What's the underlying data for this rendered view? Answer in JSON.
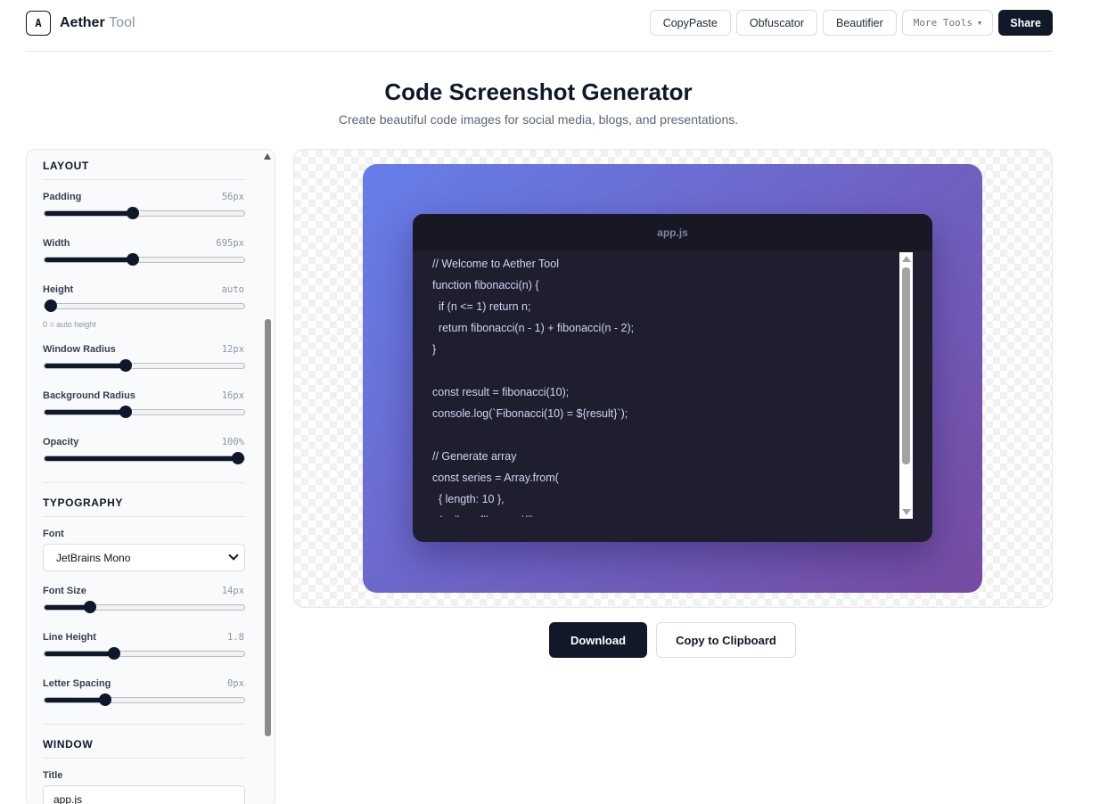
{
  "header": {
    "logo_letter": "A",
    "brand_main": "Aether",
    "brand_sub": "Tool",
    "nav": {
      "copypaste": "CopyPaste",
      "obfuscator": "Obfuscator",
      "beautifier": "Beautifier",
      "more_tools": "More Tools",
      "share": "Share"
    }
  },
  "page": {
    "title": "Code Screenshot Generator",
    "subtitle": "Create beautiful code images for social media, blogs, and presentations."
  },
  "sidebar": {
    "layout_heading": "LAYOUT",
    "padding": {
      "label": "Padding",
      "value": "56px",
      "level": 0.44
    },
    "width": {
      "label": "Width",
      "value": "695px",
      "level": 0.44
    },
    "height": {
      "label": "Height",
      "value": "auto",
      "level": 0.0,
      "hint": "0 = auto height"
    },
    "window_radius": {
      "label": "Window Radius",
      "value": "12px",
      "level": 0.4
    },
    "background_radius": {
      "label": "Background Radius",
      "value": "16px",
      "level": 0.4
    },
    "opacity": {
      "label": "Opacity",
      "value": "100%",
      "level": 1.0
    },
    "typography_heading": "TYPOGRAPHY",
    "font": {
      "label": "Font",
      "value": "JetBrains Mono"
    },
    "font_size": {
      "label": "Font Size",
      "value": "14px",
      "level": 0.21
    },
    "line_height": {
      "label": "Line Height",
      "value": "1.8",
      "level": 0.34
    },
    "letter_spacing": {
      "label": "Letter Spacing",
      "value": "0px",
      "level": 0.29
    },
    "window_heading": "WINDOW",
    "title_field": {
      "label": "Title",
      "value": "app.js"
    }
  },
  "preview": {
    "window_title": "app.js",
    "gradient": [
      "#667eea",
      "#764ba2"
    ],
    "code_lines": [
      "// Welcome to Aether Tool",
      "function fibonacci(n) {",
      "  if (n <= 1) return n;",
      "  return fibonacci(n - 1) + fibonacci(n - 2);",
      "}",
      "",
      "const result = fibonacci(10);",
      "console.log(`Fibonacci(10) = ${result}`);",
      "",
      "// Generate array",
      "const series = Array.from(",
      "  { length: 10 },",
      "  (_, i) => fibonacci(i)"
    ]
  },
  "actions": {
    "download": "Download",
    "copy": "Copy to Clipboard"
  }
}
